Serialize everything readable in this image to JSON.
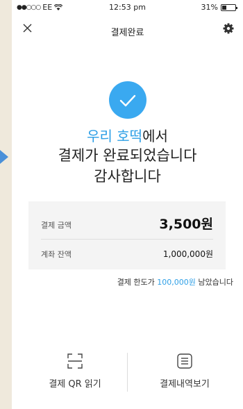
{
  "status_bar": {
    "signal_dots": "●●○○○",
    "carrier": "EE",
    "wifi_icon": "wifi-icon",
    "time": "12:53 pm",
    "battery": "31%",
    "battery_level": 0.31
  },
  "navbar": {
    "title": "결제완료",
    "close_icon": "close-icon",
    "settings_icon": "gear-icon"
  },
  "message": {
    "store": "우리 호떡",
    "suffix": "에서",
    "line2": "결제가 완료되었습니다",
    "line3": "감사합니다"
  },
  "summary": {
    "payment_label": "결제 금액",
    "payment_amount": "3,500원",
    "balance_label": "계좌 잔액",
    "balance_amount": "1,000,000원"
  },
  "limit": {
    "prefix": "결제 한도가 ",
    "amount": "100,000원",
    "suffix": " 남았습니다"
  },
  "actions": {
    "qr_label": "결제 QR 읽기",
    "history_label": "결제내역보기"
  },
  "colors": {
    "accent": "#3aa9f0",
    "arrow": "#4a90d9",
    "background": "#efe9dc"
  }
}
